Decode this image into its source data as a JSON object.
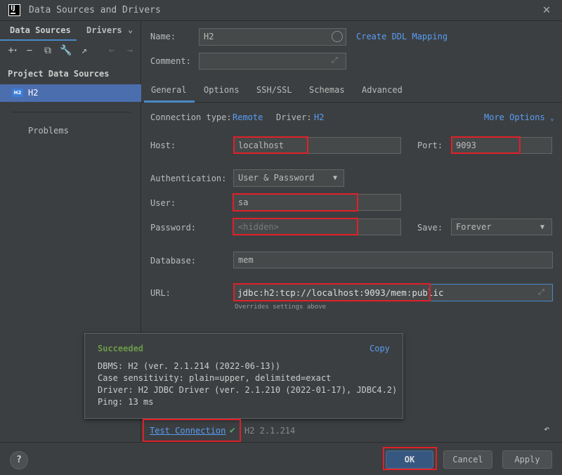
{
  "window": {
    "title": "Data Sources and Drivers",
    "logo_text": "IJ"
  },
  "sidebar": {
    "tabs": [
      {
        "label": "Data Sources"
      },
      {
        "label": "Drivers"
      }
    ],
    "section_title": "Project Data Sources",
    "items": [
      {
        "badge": "H2",
        "label": "H2"
      }
    ],
    "problems_label": "Problems"
  },
  "form": {
    "name_label": "Name:",
    "name_value": "H2",
    "create_ddl_link": "Create DDL Mapping",
    "comment_label": "Comment:",
    "comment_value": "",
    "tabs": [
      {
        "label": "General"
      },
      {
        "label": "Options"
      },
      {
        "label": "SSH/SSL"
      },
      {
        "label": "Schemas"
      },
      {
        "label": "Advanced"
      }
    ],
    "connection_type_label": "Connection type:",
    "connection_type_value": "Remote",
    "driver_label": "Driver:",
    "driver_value": "H2",
    "more_options": "More Options",
    "host_label": "Host:",
    "host_value": "localhost",
    "port_label": "Port:",
    "port_value": "9093",
    "auth_label": "Authentication:",
    "auth_value": "User & Password",
    "user_label": "User:",
    "user_value": "sa",
    "password_label": "Password:",
    "password_placeholder": "<hidden>",
    "save_label": "Save:",
    "save_value": "Forever",
    "database_label": "Database:",
    "database_value": "mem",
    "url_label": "URL:",
    "url_value": "jdbc:h2:tcp://localhost:9093/mem:public",
    "url_hint": "Overrides settings above"
  },
  "popup": {
    "status": "Succeeded",
    "copy": "Copy",
    "lines": [
      "DBMS: H2 (ver. 2.1.214 (2022-06-13))",
      "Case sensitivity: plain=upper, delimited=exact",
      "Driver: H2 JDBC Driver (ver. 2.1.210 (2022-01-17), JDBC4.2)",
      "Ping: 13 ms"
    ]
  },
  "test_connection": {
    "label": "Test Connection",
    "version": "H2 2.1.214"
  },
  "buttons": {
    "help": "?",
    "ok": "OK",
    "cancel": "Cancel",
    "apply": "Apply"
  },
  "colors": {
    "accent": "#4a88c7",
    "highlight": "#e0202a",
    "success": "#59a869",
    "link": "#589df6"
  }
}
